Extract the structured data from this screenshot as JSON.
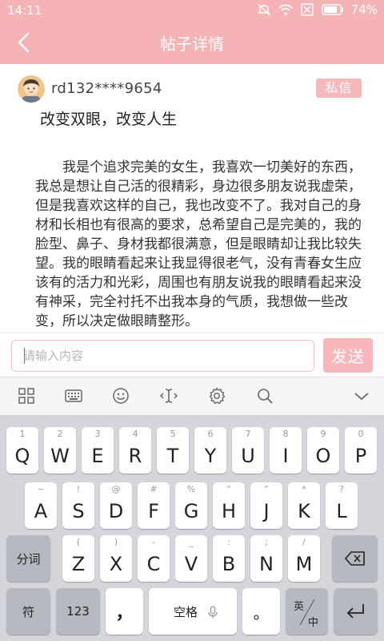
{
  "status_bar": {
    "time": "14:11",
    "battery": "74%"
  },
  "header": {
    "title": "帖子详情"
  },
  "post": {
    "username": "rd132****9654",
    "pm_label": "私信",
    "title": "改变双眼，改变人生",
    "body": "我是个追求完美的女生，我喜欢一切美好的东西，我总是想让自己活的很精彩，身边很多朋友说我虚荣，但是我喜欢这样的自己，我也改变不了。我对自己的身材和长相也有很高的要求，总希望自己是完美的，我的脸型、鼻子、身材我都很满意，但是眼睛却让我比较失望。我的眼睛看起来让我显得很老气，没有青春女生应该有的活力和光彩，周围也有朋友说我的眼睛看起来没有神采，完全衬托不出我本身的气质，我想做一些改变，所以决定做眼睛整形。"
  },
  "comment": {
    "placeholder": "请输入内容",
    "send_label": "发送"
  },
  "keyboard": {
    "toolbar": [
      "grid-icon",
      "keyboard-icon",
      "emoji-icon",
      "cursor-icon",
      "settings-icon",
      "search-icon",
      "collapse-icon"
    ],
    "row1": [
      {
        "main": "Q",
        "sub": "1"
      },
      {
        "main": "W",
        "sub": "2"
      },
      {
        "main": "E",
        "sub": "3"
      },
      {
        "main": "R",
        "sub": "4"
      },
      {
        "main": "T",
        "sub": "5"
      },
      {
        "main": "Y",
        "sub": "6"
      },
      {
        "main": "U",
        "sub": "7"
      },
      {
        "main": "I",
        "sub": "8"
      },
      {
        "main": "O",
        "sub": "9"
      },
      {
        "main": "P",
        "sub": "0"
      }
    ],
    "row2": [
      {
        "main": "A",
        "sub": "~"
      },
      {
        "main": "S",
        "sub": "!"
      },
      {
        "main": "D",
        "sub": "@"
      },
      {
        "main": "F",
        "sub": "#"
      },
      {
        "main": "G",
        "sub": "%"
      },
      {
        "main": "H",
        "sub": "“"
      },
      {
        "main": "J",
        "sub": "”"
      },
      {
        "main": "K",
        "sub": "*"
      },
      {
        "main": "L",
        "sub": "?"
      }
    ],
    "row3": [
      {
        "main": "Z",
        "sub": "("
      },
      {
        "main": "X",
        "sub": ")"
      },
      {
        "main": "C",
        "sub": "-"
      },
      {
        "main": "V",
        "sub": "_"
      },
      {
        "main": "B",
        "sub": ":"
      },
      {
        "main": "N",
        "sub": ";"
      },
      {
        "main": "M",
        "sub": "/"
      }
    ],
    "segment_label": "分词",
    "symbol_label": "符",
    "num_label": "123",
    "comma_label": "，",
    "space_label": "空格",
    "period_label": "。",
    "lang_top": "英",
    "lang_bottom": "中"
  }
}
